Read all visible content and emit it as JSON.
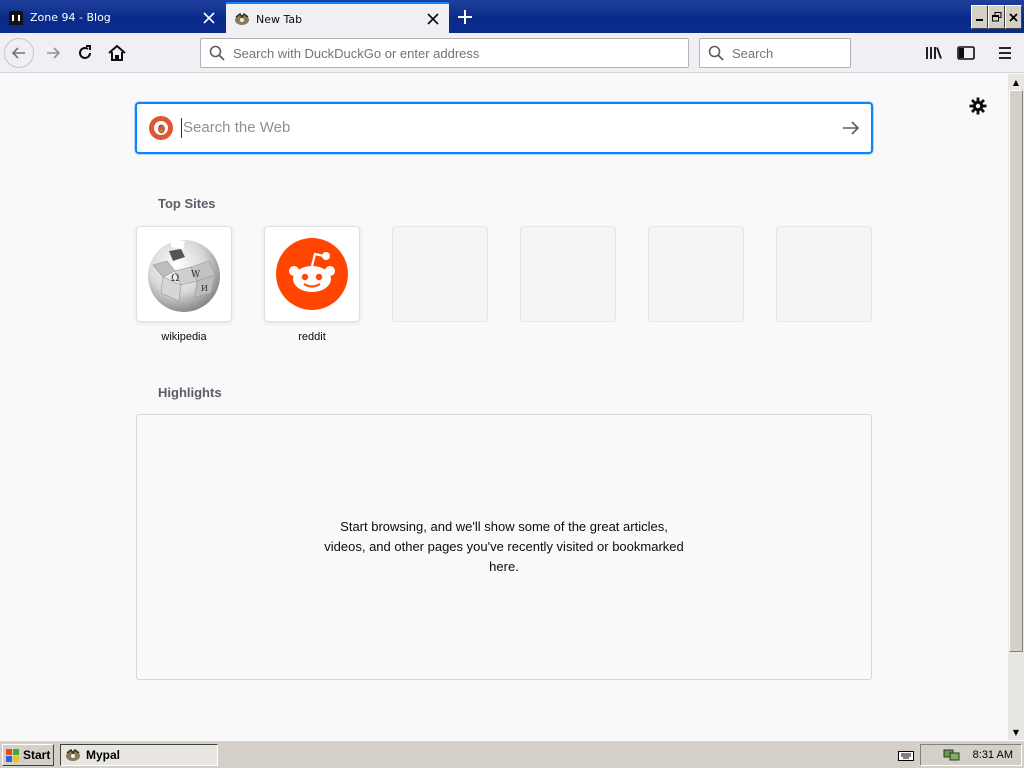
{
  "tabs": [
    {
      "title": "Zone 94 - Blog",
      "favicon": "zone94-icon",
      "active": false
    },
    {
      "title": "New Tab",
      "favicon": "mypal-icon",
      "active": true
    }
  ],
  "navbar": {
    "url_placeholder": "Search with DuckDuckGo or enter address",
    "search_placeholder": "Search"
  },
  "newtab": {
    "search_placeholder": "Search the Web",
    "top_sites_title": "Top Sites",
    "top_sites": [
      {
        "label": "wikipedia",
        "icon": "wikipedia-logo"
      },
      {
        "label": "reddit",
        "icon": "reddit-logo"
      },
      {
        "label": "",
        "icon": ""
      },
      {
        "label": "",
        "icon": ""
      },
      {
        "label": "",
        "icon": ""
      },
      {
        "label": "",
        "icon": ""
      }
    ],
    "highlights_title": "Highlights",
    "highlights_message": "Start browsing, and we'll show some of the great articles, videos, and other pages you've recently visited or bookmarked here."
  },
  "taskbar": {
    "start_label": "Start",
    "task_label": "Mypal",
    "clock": "8:31 AM"
  },
  "colors": {
    "accent": "#0a84ff",
    "titlebar": "#0a2a8a",
    "reddit": "#ff4500",
    "ddg": "#de5833"
  }
}
